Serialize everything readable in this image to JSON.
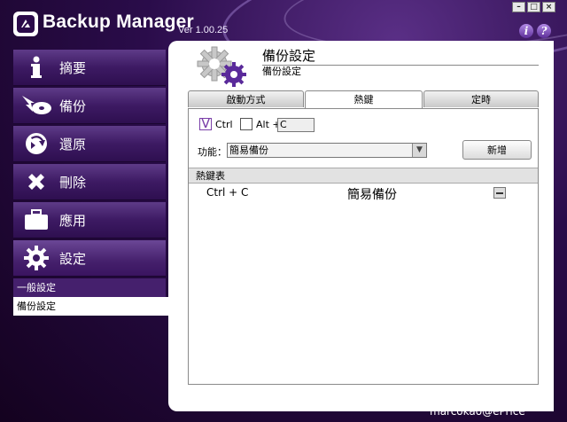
{
  "app": {
    "title": "Backup Manager",
    "version": "Ver 1.00.25",
    "help_icons": [
      "i",
      "?"
    ]
  },
  "sidebar": {
    "items": [
      {
        "label": "摘要",
        "icon": "info-icon"
      },
      {
        "label": "備份",
        "icon": "backup-disc-icon"
      },
      {
        "label": "還原",
        "icon": "restore-arrow-icon"
      },
      {
        "label": "刪除",
        "icon": "delete-x-icon"
      },
      {
        "label": "應用",
        "icon": "briefcase-icon"
      },
      {
        "label": "設定",
        "icon": "gear-icon"
      }
    ],
    "sub_items": [
      {
        "label": "一般設定"
      },
      {
        "label": "備份設定"
      }
    ]
  },
  "header": {
    "title": "備份設定",
    "subtitle": "備份設定"
  },
  "tabs": [
    {
      "label": "啟動方式"
    },
    {
      "label": "熱鍵"
    },
    {
      "label": "定時"
    }
  ],
  "hotkey": {
    "ctrl_label": "Ctrl",
    "ctrl_checked": true,
    "alt_label": "Alt +",
    "alt_checked": false,
    "key_value": "C",
    "function_label": "功能：",
    "function_value": "簡易備份",
    "add_button": "新增",
    "list_header": "熱鍵表",
    "rows": [
      {
        "keys": "Ctrl + C",
        "action": "簡易備份"
      }
    ]
  },
  "watermark": "marcokao@ePrice",
  "colors": {
    "accent_purple": "#45206d",
    "check_purple": "#7a3fa8"
  }
}
